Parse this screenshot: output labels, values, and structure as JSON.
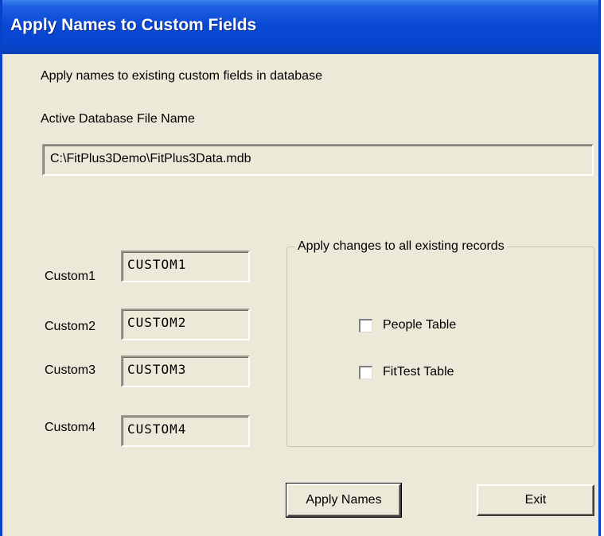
{
  "window": {
    "title": "Apply Names to Custom Fields"
  },
  "description": "Apply names to existing custom fields in database",
  "database": {
    "label": "Active Database File Name",
    "file_path": "C:\\FitPlus3Demo\\FitPlus3Data.mdb"
  },
  "custom_fields": [
    {
      "label": "Custom1",
      "value": "CUSTOM1"
    },
    {
      "label": "Custom2",
      "value": "CUSTOM2"
    },
    {
      "label": "Custom3",
      "value": "CUSTOM3"
    },
    {
      "label": "Custom4",
      "value": "CUSTOM4"
    }
  ],
  "apply_group": {
    "legend": "Apply changes to all existing records",
    "people_table_label": "People Table",
    "people_table_checked": false,
    "fittest_table_label": "FitTest Table",
    "fittest_table_checked": false
  },
  "buttons": {
    "apply_names": "Apply Names",
    "exit": "Exit"
  },
  "colors": {
    "titlebar": "#0a49d6",
    "window_bg": "#ece9d8"
  }
}
